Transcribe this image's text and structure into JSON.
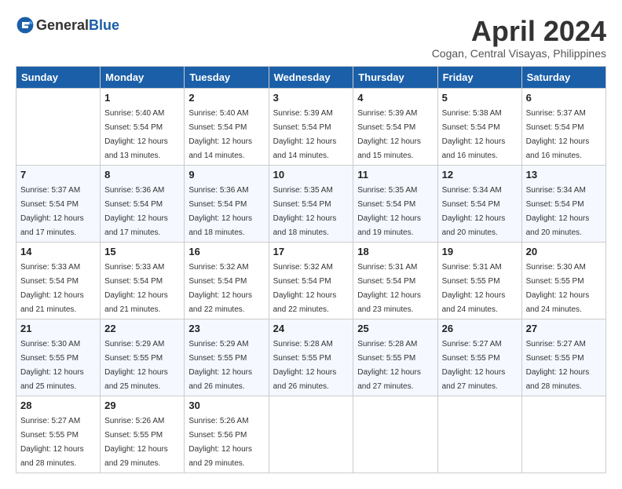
{
  "header": {
    "logo_general": "General",
    "logo_blue": "Blue",
    "month_year": "April 2024",
    "location": "Cogan, Central Visayas, Philippines"
  },
  "weekdays": [
    "Sunday",
    "Monday",
    "Tuesday",
    "Wednesday",
    "Thursday",
    "Friday",
    "Saturday"
  ],
  "weeks": [
    [
      {
        "day": "",
        "sunrise": "",
        "sunset": "",
        "daylight": ""
      },
      {
        "day": "1",
        "sunrise": "Sunrise: 5:40 AM",
        "sunset": "Sunset: 5:54 PM",
        "daylight": "Daylight: 12 hours and 13 minutes."
      },
      {
        "day": "2",
        "sunrise": "Sunrise: 5:40 AM",
        "sunset": "Sunset: 5:54 PM",
        "daylight": "Daylight: 12 hours and 14 minutes."
      },
      {
        "day": "3",
        "sunrise": "Sunrise: 5:39 AM",
        "sunset": "Sunset: 5:54 PM",
        "daylight": "Daylight: 12 hours and 14 minutes."
      },
      {
        "day": "4",
        "sunrise": "Sunrise: 5:39 AM",
        "sunset": "Sunset: 5:54 PM",
        "daylight": "Daylight: 12 hours and 15 minutes."
      },
      {
        "day": "5",
        "sunrise": "Sunrise: 5:38 AM",
        "sunset": "Sunset: 5:54 PM",
        "daylight": "Daylight: 12 hours and 16 minutes."
      },
      {
        "day": "6",
        "sunrise": "Sunrise: 5:37 AM",
        "sunset": "Sunset: 5:54 PM",
        "daylight": "Daylight: 12 hours and 16 minutes."
      }
    ],
    [
      {
        "day": "7",
        "sunrise": "Sunrise: 5:37 AM",
        "sunset": "Sunset: 5:54 PM",
        "daylight": "Daylight: 12 hours and 17 minutes."
      },
      {
        "day": "8",
        "sunrise": "Sunrise: 5:36 AM",
        "sunset": "Sunset: 5:54 PM",
        "daylight": "Daylight: 12 hours and 17 minutes."
      },
      {
        "day": "9",
        "sunrise": "Sunrise: 5:36 AM",
        "sunset": "Sunset: 5:54 PM",
        "daylight": "Daylight: 12 hours and 18 minutes."
      },
      {
        "day": "10",
        "sunrise": "Sunrise: 5:35 AM",
        "sunset": "Sunset: 5:54 PM",
        "daylight": "Daylight: 12 hours and 18 minutes."
      },
      {
        "day": "11",
        "sunrise": "Sunrise: 5:35 AM",
        "sunset": "Sunset: 5:54 PM",
        "daylight": "Daylight: 12 hours and 19 minutes."
      },
      {
        "day": "12",
        "sunrise": "Sunrise: 5:34 AM",
        "sunset": "Sunset: 5:54 PM",
        "daylight": "Daylight: 12 hours and 20 minutes."
      },
      {
        "day": "13",
        "sunrise": "Sunrise: 5:34 AM",
        "sunset": "Sunset: 5:54 PM",
        "daylight": "Daylight: 12 hours and 20 minutes."
      }
    ],
    [
      {
        "day": "14",
        "sunrise": "Sunrise: 5:33 AM",
        "sunset": "Sunset: 5:54 PM",
        "daylight": "Daylight: 12 hours and 21 minutes."
      },
      {
        "day": "15",
        "sunrise": "Sunrise: 5:33 AM",
        "sunset": "Sunset: 5:54 PM",
        "daylight": "Daylight: 12 hours and 21 minutes."
      },
      {
        "day": "16",
        "sunrise": "Sunrise: 5:32 AM",
        "sunset": "Sunset: 5:54 PM",
        "daylight": "Daylight: 12 hours and 22 minutes."
      },
      {
        "day": "17",
        "sunrise": "Sunrise: 5:32 AM",
        "sunset": "Sunset: 5:54 PM",
        "daylight": "Daylight: 12 hours and 22 minutes."
      },
      {
        "day": "18",
        "sunrise": "Sunrise: 5:31 AM",
        "sunset": "Sunset: 5:54 PM",
        "daylight": "Daylight: 12 hours and 23 minutes."
      },
      {
        "day": "19",
        "sunrise": "Sunrise: 5:31 AM",
        "sunset": "Sunset: 5:55 PM",
        "daylight": "Daylight: 12 hours and 24 minutes."
      },
      {
        "day": "20",
        "sunrise": "Sunrise: 5:30 AM",
        "sunset": "Sunset: 5:55 PM",
        "daylight": "Daylight: 12 hours and 24 minutes."
      }
    ],
    [
      {
        "day": "21",
        "sunrise": "Sunrise: 5:30 AM",
        "sunset": "Sunset: 5:55 PM",
        "daylight": "Daylight: 12 hours and 25 minutes."
      },
      {
        "day": "22",
        "sunrise": "Sunrise: 5:29 AM",
        "sunset": "Sunset: 5:55 PM",
        "daylight": "Daylight: 12 hours and 25 minutes."
      },
      {
        "day": "23",
        "sunrise": "Sunrise: 5:29 AM",
        "sunset": "Sunset: 5:55 PM",
        "daylight": "Daylight: 12 hours and 26 minutes."
      },
      {
        "day": "24",
        "sunrise": "Sunrise: 5:28 AM",
        "sunset": "Sunset: 5:55 PM",
        "daylight": "Daylight: 12 hours and 26 minutes."
      },
      {
        "day": "25",
        "sunrise": "Sunrise: 5:28 AM",
        "sunset": "Sunset: 5:55 PM",
        "daylight": "Daylight: 12 hours and 27 minutes."
      },
      {
        "day": "26",
        "sunrise": "Sunrise: 5:27 AM",
        "sunset": "Sunset: 5:55 PM",
        "daylight": "Daylight: 12 hours and 27 minutes."
      },
      {
        "day": "27",
        "sunrise": "Sunrise: 5:27 AM",
        "sunset": "Sunset: 5:55 PM",
        "daylight": "Daylight: 12 hours and 28 minutes."
      }
    ],
    [
      {
        "day": "28",
        "sunrise": "Sunrise: 5:27 AM",
        "sunset": "Sunset: 5:55 PM",
        "daylight": "Daylight: 12 hours and 28 minutes."
      },
      {
        "day": "29",
        "sunrise": "Sunrise: 5:26 AM",
        "sunset": "Sunset: 5:55 PM",
        "daylight": "Daylight: 12 hours and 29 minutes."
      },
      {
        "day": "30",
        "sunrise": "Sunrise: 5:26 AM",
        "sunset": "Sunset: 5:56 PM",
        "daylight": "Daylight: 12 hours and 29 minutes."
      },
      {
        "day": "",
        "sunrise": "",
        "sunset": "",
        "daylight": ""
      },
      {
        "day": "",
        "sunrise": "",
        "sunset": "",
        "daylight": ""
      },
      {
        "day": "",
        "sunrise": "",
        "sunset": "",
        "daylight": ""
      },
      {
        "day": "",
        "sunrise": "",
        "sunset": "",
        "daylight": ""
      }
    ]
  ]
}
